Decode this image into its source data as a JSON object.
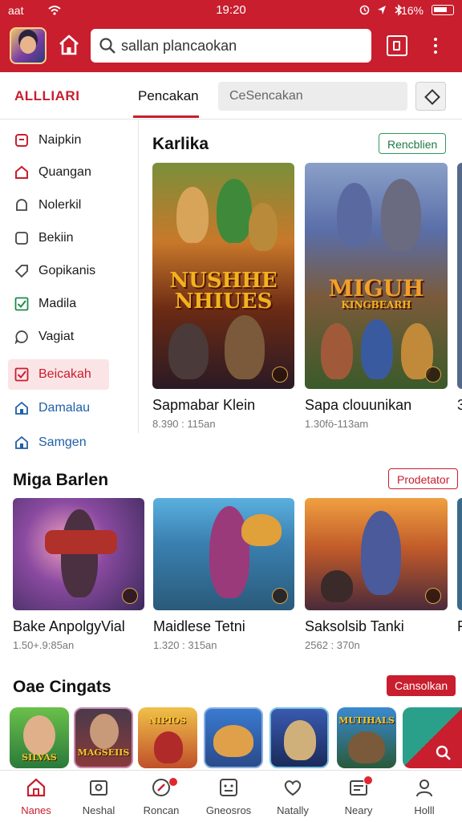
{
  "status_bar": {
    "carrier": "aat",
    "time": "19:20",
    "battery": "16%",
    "right_icons": [
      "alarm-icon",
      "location-icon",
      "bluetooth-icon"
    ]
  },
  "app_bar": {
    "search_value": "sallan plancaokan",
    "accent_color": "#c81e2e"
  },
  "tabs": {
    "brand": "ALLLIARI",
    "active_tab": "Pencakan",
    "tab2": "CeSencakan"
  },
  "sidebar": {
    "items": [
      {
        "label": "Naipkin",
        "icon": "bookmark-icon"
      },
      {
        "label": "Quangan",
        "icon": "home-icon"
      },
      {
        "label": "Nolerkil",
        "icon": "bell-icon"
      },
      {
        "label": "Bekiin",
        "icon": "square-icon"
      },
      {
        "label": "Gopikanis",
        "icon": "tag-icon"
      },
      {
        "label": "Madila",
        "icon": "check-icon"
      },
      {
        "label": "Vagiat",
        "icon": "chat-icon"
      },
      {
        "label": "Beicakah",
        "icon": "checkbox-icon",
        "active": true
      },
      {
        "label": "Damalau",
        "icon": "house-icon"
      },
      {
        "label": "Samgen",
        "icon": "house-icon"
      }
    ]
  },
  "section1": {
    "title": "Karlika",
    "action": "Rencblien",
    "cards": [
      {
        "title": "Sapmabar Klein",
        "meta": "8.390 : 115an",
        "cover_text_1": "NUSHHE",
        "cover_text_2": "NHIUES"
      },
      {
        "title": "Sapa clouunikan",
        "meta": "1.30fö-113am",
        "cover_text_1": "MIGUH",
        "cover_text_2": "KINGBEARH"
      },
      {
        "title": "3",
        "meta": ""
      }
    ]
  },
  "section2": {
    "title": "Miga Barlen",
    "action": "Prodetator",
    "cards": [
      {
        "title": "Bake AnpolgyVial",
        "meta": "1.50+.9:85an"
      },
      {
        "title": "Maidlese Tetni",
        "meta": "1.320 : 315an"
      },
      {
        "title": "Saksolsib Tanki",
        "meta": "2562 : 370n"
      },
      {
        "title": "F",
        "meta": ""
      }
    ]
  },
  "section3": {
    "title": "Oae Cingats",
    "action": "Cansolkan",
    "apps": [
      {
        "label": "SILVAS"
      },
      {
        "label": "MAGSEIIS"
      },
      {
        "label": "NIPIOS"
      },
      {
        "label": ""
      },
      {
        "label": ""
      },
      {
        "label": "MUTIHALS"
      },
      {
        "label": ""
      }
    ]
  },
  "bottom_nav": [
    {
      "label": "Nanes",
      "icon": "home-icon",
      "active": true
    },
    {
      "label": "Neshal",
      "icon": "news-icon"
    },
    {
      "label": "Roncan",
      "icon": "compass-icon",
      "badge": true
    },
    {
      "label": "Gneosros",
      "icon": "grid-icon"
    },
    {
      "label": "Natally",
      "icon": "heart-icon"
    },
    {
      "label": "Neary",
      "icon": "mail-icon",
      "badge": true
    },
    {
      "label": "Holll",
      "icon": "user-icon"
    }
  ]
}
